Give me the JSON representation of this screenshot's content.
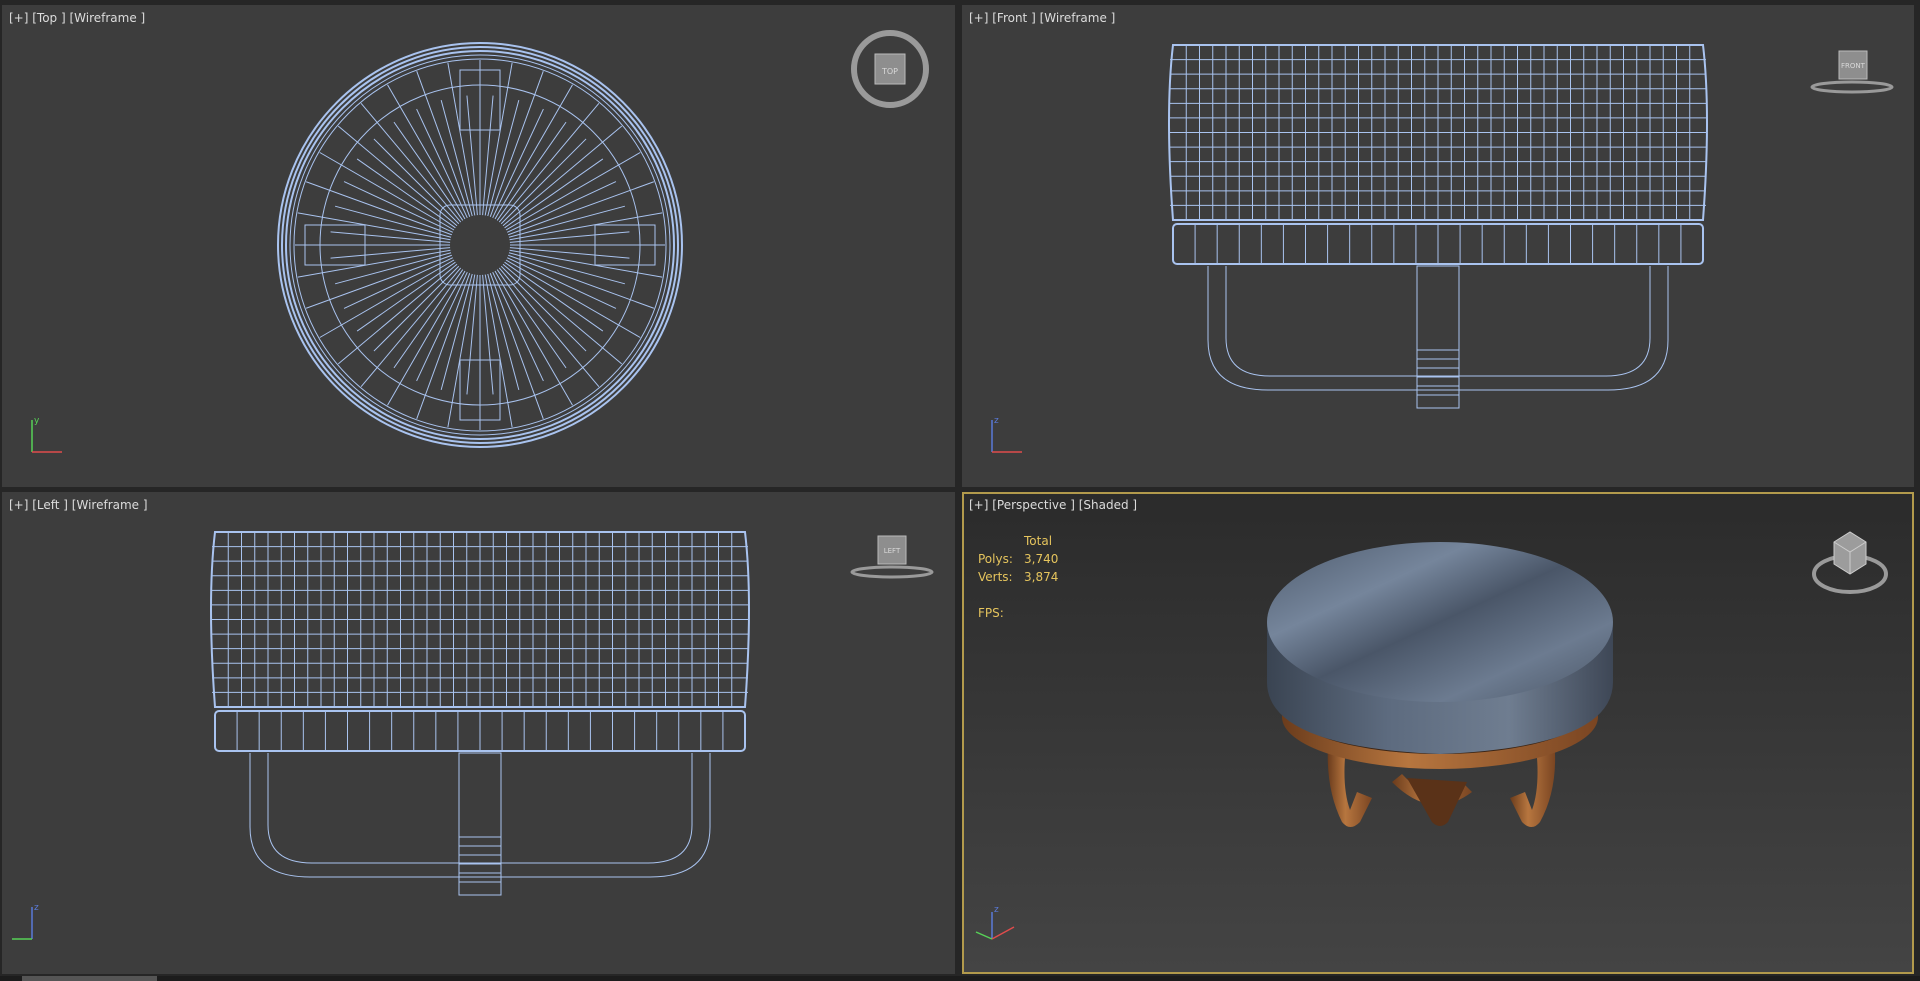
{
  "viewports": {
    "top": {
      "label": "[+] [Top ] [Wireframe ]",
      "cube_label": "TOP"
    },
    "front": {
      "label": "[+] [Front ] [Wireframe ]",
      "cube_label": "FRONT"
    },
    "left": {
      "label": "[+] [Left ] [Wireframe ]",
      "cube_label": "LEFT"
    },
    "perspective": {
      "label": "[+] [Perspective ] [Shaded ]"
    }
  },
  "stats": {
    "header": "Total",
    "polys_label": "Polys:",
    "polys_value": "3,740",
    "verts_label": "Verts:",
    "verts_value": "3,874",
    "fps_label": "FPS:"
  },
  "axes": {
    "x": "x",
    "y": "y",
    "z": "z"
  },
  "colors": {
    "wire": "#a9c3ef",
    "viewport_bg": "#3d3d3d",
    "active_border": "#b29a4c",
    "stats_text": "#e5c45d",
    "cushion": "#5f6f84",
    "wood": "#a8673a"
  }
}
